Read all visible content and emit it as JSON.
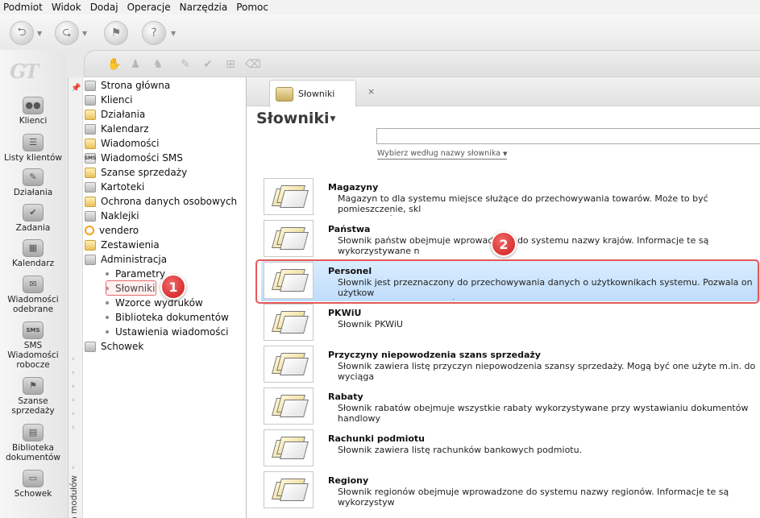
{
  "menu": [
    "Podmiot",
    "Widok",
    "Dodaj",
    "Operacje",
    "Narzędzia",
    "Pomoc"
  ],
  "modules": [
    {
      "label": "Klienci",
      "icon": "people-icon"
    },
    {
      "label": "Listy klientów",
      "icon": "contact-list-icon"
    },
    {
      "label": "Działania",
      "icon": "actions-icon"
    },
    {
      "label": "Zadania",
      "icon": "tasks-icon"
    },
    {
      "label": "Kalendarz",
      "icon": "calendar-icon"
    },
    {
      "label": "Wiadomości odebrane",
      "icon": "inbox-icon"
    },
    {
      "label": "SMS Wiadomości robocze",
      "icon": "sms-icon",
      "badge": "SMS"
    },
    {
      "label": "Szanse sprzedaży",
      "icon": "sales-opportunity-icon"
    },
    {
      "label": "Biblioteka dokumentów",
      "icon": "document-library-icon"
    },
    {
      "label": "Schowek",
      "icon": "clipboard-icon"
    }
  ],
  "side_strip_label": "Lista modułów",
  "tree": [
    {
      "label": "Strona główna",
      "icon": "home-icon"
    },
    {
      "label": "Klienci",
      "icon": "clients-icon"
    },
    {
      "label": "Działania",
      "icon": "actions-icon"
    },
    {
      "label": "Kalendarz",
      "icon": "calendar-icon"
    },
    {
      "label": "Wiadomości",
      "icon": "messages-icon"
    },
    {
      "label": "Wiadomości SMS",
      "icon": "sms-icon",
      "badge": "SMS"
    },
    {
      "label": "Szanse sprzedaży",
      "icon": "opportunity-icon"
    },
    {
      "label": "Kartoteki",
      "icon": "files-icon"
    },
    {
      "label": "Ochrona danych osobowych",
      "icon": "data-protection-icon"
    },
    {
      "label": "Naklejki",
      "icon": "stickers-icon"
    },
    {
      "label": "vendero",
      "icon": "vendero-icon"
    },
    {
      "label": "Zestawienia",
      "icon": "reports-icon"
    },
    {
      "label": "Administracja",
      "icon": "admin-icon"
    }
  ],
  "tree_sub": [
    "Parametry",
    "Słowniki",
    "Wzorce wydruków",
    "Biblioteka dokumentów",
    "Ustawienia wiadomości"
  ],
  "tree_last": {
    "label": "Schowek",
    "icon": "folder-icon"
  },
  "tab": {
    "label": "Słowniki",
    "close": "×"
  },
  "page_title": "Słowniki",
  "search": {
    "value": "",
    "hint": "Wybierz według nazwy słownika"
  },
  "dictionaries": [
    {
      "name": "Magazyny",
      "desc": "Magazyn to dla systemu miejsce służące do przechowywania towarów. Może to być pomieszczenie, skl\npogrupować dokumenty magazynowe na odrębne zbiory."
    },
    {
      "name": "Państwa",
      "desc": "Słownik państw obejmuje wprowadzone do systemu nazwy krajów. Informacje te są wykorzystywane n"
    },
    {
      "name": "Personel",
      "desc": "Słownik jest przeznaczony do przechowywania danych o użytkownikach systemu. Pozwala on użytkow\nuprawnienia do poszczególnych opcji programu.",
      "selected": true
    },
    {
      "name": "PKWiU",
      "desc": "Słownik PKWiU"
    },
    {
      "name": "Przyczyny niepowodzenia szans sprzedaży",
      "desc": "Słownik zawiera listę przyczyn niepowodzenia szansy sprzedaży. Mogą być one użyte m.in. do wyciąga"
    },
    {
      "name": "Rabaty",
      "desc": "Słownik rabatów obejmuje wszystkie rabaty wykorzystywane przy wystawianiu dokumentów handlowy"
    },
    {
      "name": "Rachunki podmiotu",
      "desc": "Słownik zawiera listę rachunków bankowych podmiotu."
    },
    {
      "name": "Regiony",
      "desc": "Słownik regionów obejmuje wprowadzone do systemu nazwy regionów. Informacje te są wykorzystyw"
    }
  ],
  "markers": [
    "1",
    "2"
  ],
  "colors": {
    "selection": "#bfdcfb",
    "annotation": "#d93131"
  }
}
